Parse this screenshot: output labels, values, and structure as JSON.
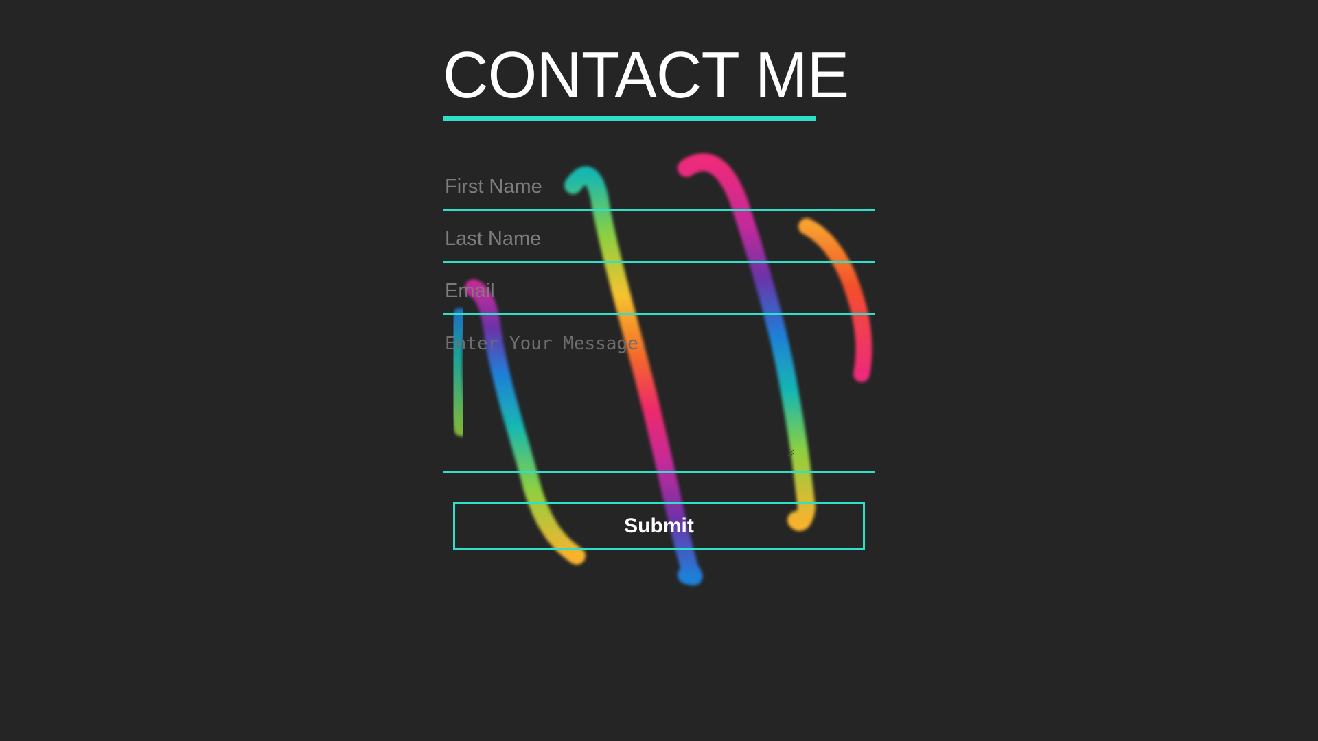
{
  "header": {
    "title": "CONTACT ME"
  },
  "form": {
    "first_name_placeholder": "First Name",
    "last_name_placeholder": "Last Name",
    "email_placeholder": "Email",
    "message_placeholder": "Enter Your Message.",
    "submit_label": "Submit"
  },
  "colors": {
    "background": "#252525",
    "accent": "#2ee0c8",
    "text": "#ffffff",
    "placeholder": "#7d7d7d"
  }
}
